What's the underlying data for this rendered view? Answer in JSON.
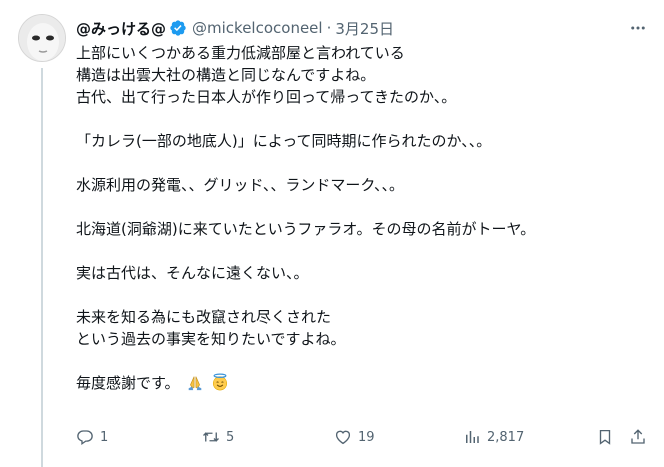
{
  "tweet": {
    "display_name": "@みっける@",
    "handle": "@mickelcoconeel",
    "separator": "·",
    "date": "3月25日",
    "lines": [
      "上部にいくつかある重力低減部屋と言われている",
      "構造は出雲大社の構造と同じなんですよね。",
      "古代、出て行った日本人が作り回って帰ってきたのか、。",
      "",
      "「カレラ(一部の地底人)」によって同時期に作られたのか、、。",
      "",
      "水源利用の発電、、グリッド、、ランドマーク、、。",
      "",
      "北海道(洞爺湖)に来ていたというファラオ。その母の名前がトーヤ。",
      "",
      "実は古代は、そんなに遠くない、。",
      "",
      "未来を知る為にも改竄され尽くされた",
      "という過去の事実を知りたいですよね。",
      "",
      "毎度感謝です。"
    ],
    "last_line_emojis": [
      "folded-hands-emoji",
      "smiling-face-with-halo-emoji"
    ]
  },
  "actions": {
    "reply_count": "1",
    "retweet_count": "5",
    "like_count": "19",
    "view_count": "2,817"
  },
  "icons": {
    "verified": "verified-badge-icon",
    "more": "more-options-icon",
    "reply": "reply-icon",
    "retweet": "retweet-icon",
    "like": "heart-icon",
    "views": "views-icon",
    "bookmark": "bookmark-icon",
    "share": "share-icon"
  },
  "colors": {
    "text": "#0f1419",
    "secondary": "#536471",
    "verified_blue": "#1d9bf0",
    "divider": "#cfd9de"
  }
}
